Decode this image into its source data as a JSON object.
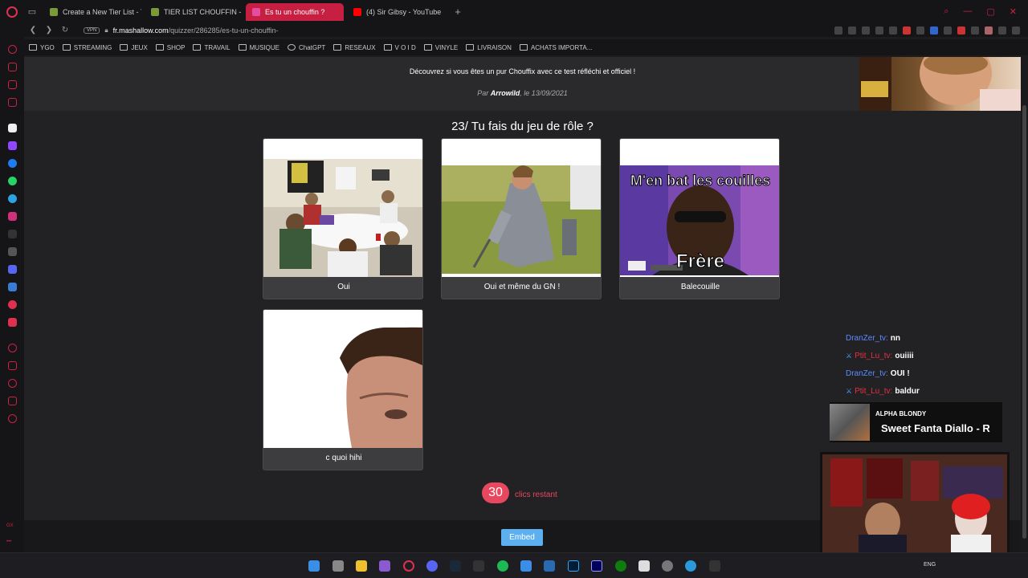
{
  "browser": {
    "tabs": [
      {
        "title": "Create a New Tier List - T",
        "color": "#7a9a3a"
      },
      {
        "title": "TIER LIST CHOUFFIN - Ti",
        "color": "#7a9a3a"
      },
      {
        "title": "Es tu un chouffin ?",
        "color": "#e64da0",
        "active": true
      },
      {
        "title": "(4) Sir Gibsy - YouTube",
        "color": "#ff0000"
      }
    ],
    "url_domain": "fr.mashallow.com",
    "url_path": "/quizzer/286285/es-tu-un-chouffin-",
    "vpn_label": "VPN"
  },
  "bookmarks": [
    "YGO",
    "STREAMING",
    "JEUX",
    "SHOP",
    "TRAVAIL",
    "MUSIQUE",
    "ChatGPT",
    "RESEAUX",
    "V O I D",
    "VINYLE",
    "LIVRAISON",
    "ACHATS IMPORTA..."
  ],
  "quiz": {
    "description": "Découvrez si vous êtes un pur Chouffix avec ce test réfléchi et officiel !",
    "byline_prefix": "Par",
    "author": "Arrowild",
    "byline_suffix": ", le 13/09/2021",
    "question": "23/ Tu fais du jeu de rôle ?",
    "answers": [
      {
        "label": "Oui"
      },
      {
        "label": "Oui et même du GN !"
      },
      {
        "label": "Balecouille",
        "meme_top": "M'en bat les couilles",
        "meme_bottom": "Frère"
      },
      {
        "label": "c quoi hihi"
      }
    ],
    "clicks_count": "30",
    "clicks_text": "clics restant",
    "embed_label": "Embed"
  },
  "chat": [
    {
      "user": "DranZer_tv:",
      "msg": "nn",
      "color": "blue",
      "badge": false
    },
    {
      "user": "Ptit_Lu_tv:",
      "msg": "ouiiii",
      "color": "red",
      "badge": true
    },
    {
      "user": "DranZer_tv:",
      "msg": "OUI !",
      "color": "blue",
      "badge": false
    },
    {
      "user": "Ptit_Lu_tv:",
      "msg": "baldur",
      "color": "red",
      "badge": true
    }
  ],
  "now_playing": {
    "artist": "ALPHA BLONDY",
    "song": "Sweet Fanta Diallo - R"
  },
  "taskbar": {
    "lang": "ENG"
  }
}
